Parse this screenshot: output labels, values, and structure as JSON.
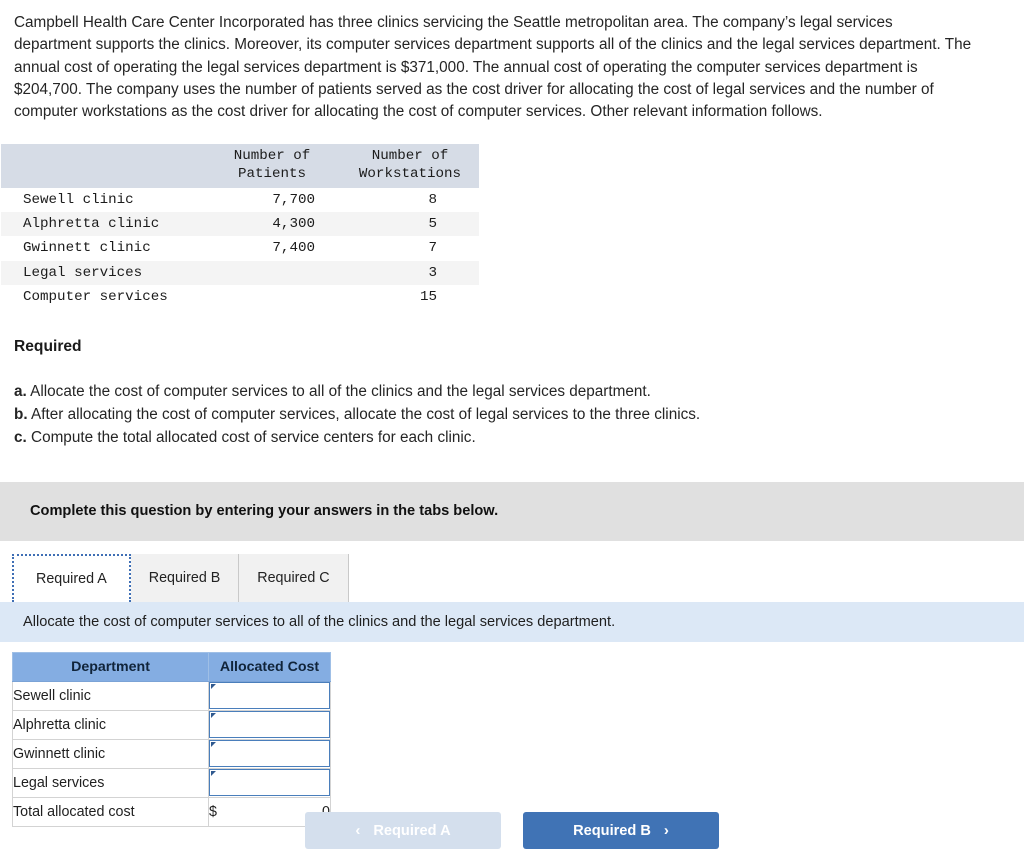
{
  "problem": {
    "narrative": "Campbell Health Care Center Incorporated has three clinics servicing the Seattle metropolitan area. The company’s legal services department supports the clinics. Moreover, its computer services department supports all of the clinics and the legal services department. The annual cost of operating the legal services department is $371,000. The annual cost of operating the computer services department is $204,700. The company uses the number of patients served as the cost driver for allocating the cost of legal services and the number of computer workstations as the cost driver for allocating the cost of computer services. Other relevant information follows."
  },
  "data_table": {
    "headers": [
      "",
      "Number of\nPatients",
      "Number of\nWorkstations"
    ],
    "header_col2_line1": "Number of",
    "header_col2_line2": "Patients",
    "header_col3_line1": "Number of",
    "header_col3_line2": "Workstations",
    "rows": [
      {
        "label": "Sewell clinic",
        "patients": "7,700",
        "workstations": "8"
      },
      {
        "label": "Alphretta clinic",
        "patients": "4,300",
        "workstations": "5"
      },
      {
        "label": "Gwinnett clinic",
        "patients": "7,400",
        "workstations": "7"
      },
      {
        "label": "Legal services",
        "patients": "",
        "workstations": "3"
      },
      {
        "label": "Computer services",
        "patients": "",
        "workstations": "15"
      }
    ]
  },
  "required": {
    "heading": "Required",
    "items": [
      {
        "marker": "a.",
        "text": "Allocate the cost of computer services to all of the clinics and the legal services department."
      },
      {
        "marker": "b.",
        "text": "After allocating the cost of computer services, allocate the cost of legal services to the three clinics."
      },
      {
        "marker": "c.",
        "text": "Compute the total allocated cost of service centers for each clinic."
      }
    ]
  },
  "gray_banner": {
    "text": "Complete this question by entering your answers in the tabs below."
  },
  "tabs": [
    {
      "label": "Required A",
      "active": true
    },
    {
      "label": "Required B",
      "active": false
    },
    {
      "label": "Required C",
      "active": false
    }
  ],
  "blue_banner": {
    "text": "Allocate the cost of computer services to all of the clinics and the legal services department."
  },
  "answer_table": {
    "columns": [
      "Department",
      "Allocated Cost"
    ],
    "rows": [
      {
        "department": "Sewell clinic",
        "value": "",
        "type": "input"
      },
      {
        "department": "Alphretta clinic",
        "value": "",
        "type": "input"
      },
      {
        "department": "Gwinnett clinic",
        "value": "",
        "type": "input"
      },
      {
        "department": "Legal services",
        "value": "",
        "type": "input"
      }
    ],
    "total_row": {
      "department": "Total allocated cost",
      "currency": "$",
      "value": "0"
    }
  },
  "nav": {
    "prev": {
      "label": "Required A",
      "chevron": "‹",
      "disabled": true
    },
    "next": {
      "label": "Required B",
      "chevron": "›",
      "disabled": false
    }
  },
  "colors": {
    "header_blue": "#84ade2",
    "banner_gray": "#e0e0e0",
    "banner_blue": "#dce8f6",
    "button_active": "#4073b5",
    "button_disabled": "#d4dfed",
    "input_border": "#4a7ebb",
    "data_header_gray": "#d6dce6"
  }
}
